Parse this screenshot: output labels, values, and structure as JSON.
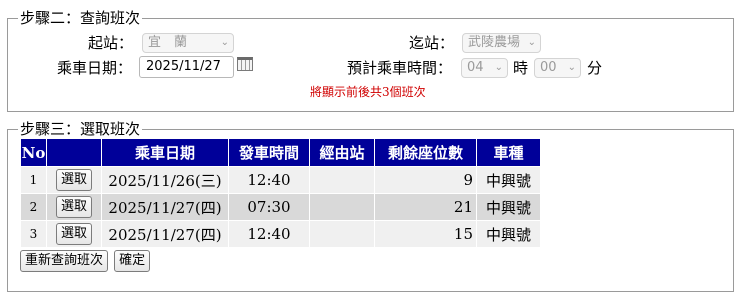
{
  "step2": {
    "legend": "步驟二：查詢班次",
    "origin_label": "起站：",
    "origin_value": "宜　蘭",
    "destination_label": "迄站：",
    "destination_value": "武陵農場",
    "date_label": "乘車日期：",
    "date_value": "2025/11/27",
    "time_label": "預計乘車時間：",
    "hour_value": "04",
    "hour_unit": "時",
    "minute_value": "00",
    "minute_unit": "分",
    "hint": "將顯示前後共3個班次"
  },
  "step3": {
    "legend": "步驟三：選取班次",
    "columns": [
      "No",
      "",
      "乘車日期",
      "發車時間",
      "經由站",
      "剩餘座位數",
      "車種"
    ],
    "rows": [
      {
        "no": "1",
        "select_label": "選取",
        "date": "2025/11/26(三)",
        "time": "12:40",
        "via": "",
        "seats": "9",
        "type": "中興號"
      },
      {
        "no": "2",
        "select_label": "選取",
        "date": "2025/11/27(四)",
        "time": "07:30",
        "via": "",
        "seats": "21",
        "type": "中興號"
      },
      {
        "no": "3",
        "select_label": "選取",
        "date": "2025/11/27(四)",
        "time": "12:40",
        "via": "",
        "seats": "15",
        "type": "中興號"
      }
    ],
    "requery_label": "重新查詢班次",
    "confirm_label": "確定"
  },
  "icons": {
    "dropdown": "chevron-down-icon",
    "calendar": "calendar-icon"
  },
  "colors": {
    "header_bg": "#000099",
    "hint_text": "#d00000"
  }
}
